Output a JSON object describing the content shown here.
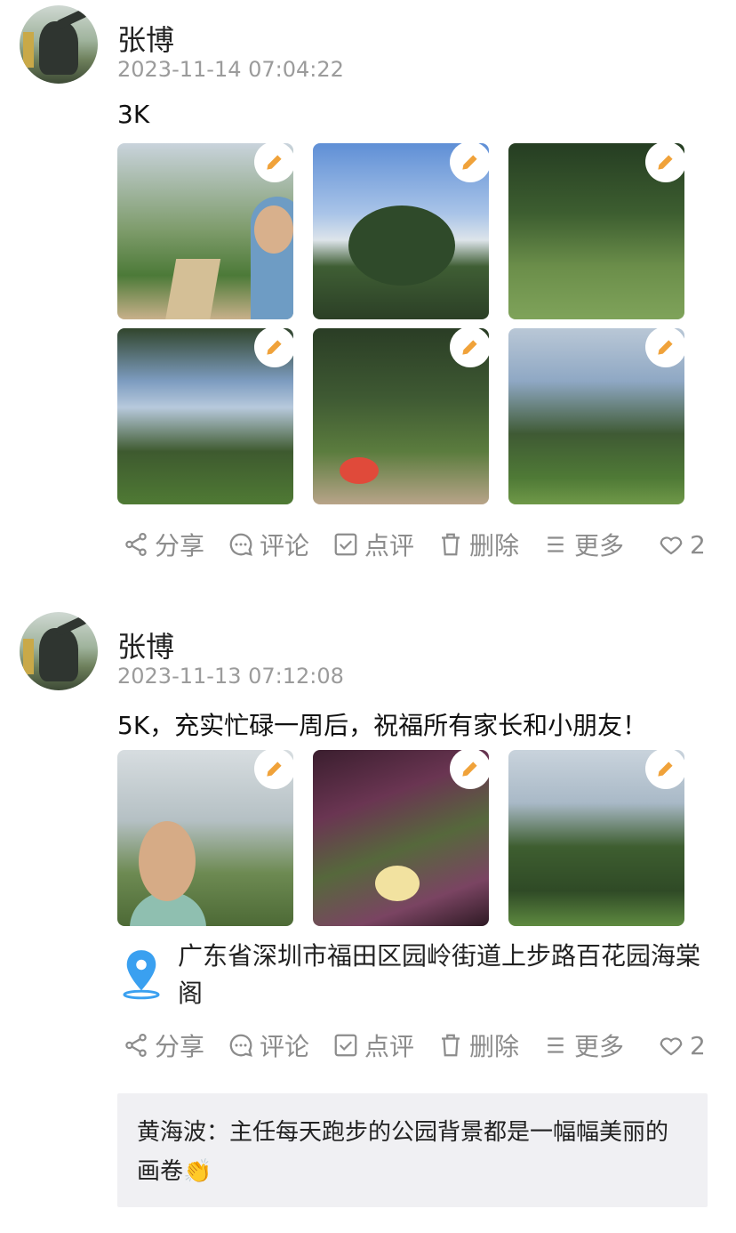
{
  "posts": [
    {
      "author": "张博",
      "timestamp": "2023-11-14 07:04:22",
      "text": "3K",
      "photos": [
        "park-path-selfie",
        "palm-sky",
        "tree-lawn",
        "garden-sky",
        "path-target",
        "palm-trees"
      ],
      "actions": {
        "share": "分享",
        "comment": "评论",
        "review": "点评",
        "delete": "删除",
        "more": "更多",
        "likes": "2"
      }
    },
    {
      "author": "张博",
      "timestamp": "2023-11-13 07:12:08",
      "text": "5K，充实忙碌一周后，祝福所有家长和小朋友！",
      "photos": [
        "selfie-park",
        "purple-plant",
        "park-trees"
      ],
      "location": "广东省深圳市福田区园岭街道上步路百花园海棠阁",
      "actions": {
        "share": "分享",
        "comment": "评论",
        "review": "点评",
        "delete": "删除",
        "more": "更多",
        "likes": "2"
      },
      "comment": {
        "text": "黄海波：主任每天跑步的公园背景都是一幅幅美丽的画卷👏"
      }
    }
  ],
  "icons": {
    "edit": "pencil-icon",
    "share": "share-icon",
    "comment": "chat-bubble-icon",
    "review": "checkbox-icon",
    "delete": "trash-icon",
    "more": "menu-icon",
    "like": "heart-icon",
    "location": "location-pin-icon"
  },
  "colors": {
    "accent_edit": "#f0a23a",
    "location_pin": "#3aa0f0",
    "muted": "#8c8c8c"
  }
}
